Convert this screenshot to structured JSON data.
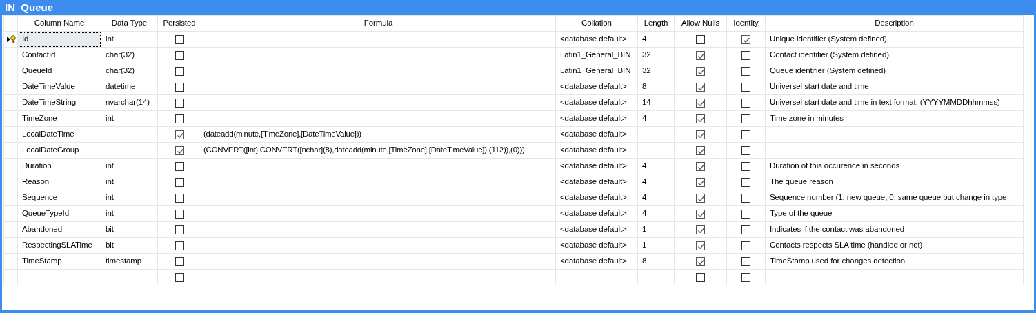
{
  "window": {
    "title": "IN_Queue"
  },
  "table": {
    "columns": [
      "Column Name",
      "Data Type",
      "Persisted",
      "Formula",
      "Collation",
      "Length",
      "Allow Nulls",
      "Identity",
      "Description"
    ],
    "rows": [
      {
        "selected": true,
        "primary_key": true,
        "name": "Id",
        "type": "int",
        "persisted": false,
        "collation": "<database default>",
        "length": "4",
        "allow_nulls": false,
        "identity": true,
        "description": "Unique identifier (System defined)"
      },
      {
        "selected": false,
        "primary_key": false,
        "name": "ContactId",
        "type": "char(32)",
        "persisted": false,
        "collation": "Latin1_General_BIN",
        "length": "32",
        "allow_nulls": true,
        "identity": false,
        "description": "Contact identifier (System defined)"
      },
      {
        "selected": false,
        "primary_key": false,
        "name": "QueueId",
        "type": "char(32)",
        "persisted": false,
        "collation": "Latin1_General_BIN",
        "length": "32",
        "allow_nulls": true,
        "identity": false,
        "description": "Queue identifier (System defined)"
      },
      {
        "selected": false,
        "primary_key": false,
        "name": "DateTimeValue",
        "type": "datetime",
        "persisted": false,
        "collation": "<database default>",
        "length": "8",
        "allow_nulls": true,
        "identity": false,
        "description": "Universel start date and time"
      },
      {
        "selected": false,
        "primary_key": false,
        "name": "DateTimeString",
        "type": "nvarchar(14)",
        "persisted": false,
        "collation": "<database default>",
        "length": "14",
        "allow_nulls": true,
        "identity": false,
        "description": "Universel start date and time in text format. (YYYYMMDDhhmmss)"
      },
      {
        "selected": false,
        "primary_key": false,
        "name": "TimeZone",
        "type": "int",
        "persisted": false,
        "collation": "<database default>",
        "length": "4",
        "allow_nulls": true,
        "identity": false,
        "description": "Time zone in minutes"
      },
      {
        "selected": false,
        "primary_key": false,
        "name": "LocalDateTime",
        "persisted": true,
        "formula": "(dateadd(minute,[TimeZone],[DateTimeValue]))",
        "collation": "<database default>",
        "allow_nulls": true,
        "identity": false
      },
      {
        "selected": false,
        "primary_key": false,
        "name": "LocalDateGroup",
        "persisted": true,
        "formula": "(CONVERT([int],CONVERT([nchar](8),dateadd(minute,[TimeZone],[DateTimeValue]),(112)),(0)))",
        "collation": "<database default>",
        "allow_nulls": true,
        "identity": false
      },
      {
        "selected": false,
        "primary_key": false,
        "name": "Duration",
        "type": "int",
        "persisted": false,
        "collation": "<database default>",
        "length": "4",
        "allow_nulls": true,
        "identity": false,
        "description": "Duration of this occurence in seconds"
      },
      {
        "selected": false,
        "primary_key": false,
        "name": "Reason",
        "type": "int",
        "persisted": false,
        "collation": "<database default>",
        "length": "4",
        "allow_nulls": true,
        "identity": false,
        "description": "The queue reason"
      },
      {
        "selected": false,
        "primary_key": false,
        "name": "Sequence",
        "type": "int",
        "persisted": false,
        "collation": "<database default>",
        "length": "4",
        "allow_nulls": true,
        "identity": false,
        "description": "Sequence number (1: new queue, 0: same queue but change in type"
      },
      {
        "selected": false,
        "primary_key": false,
        "name": "QueueTypeId",
        "type": "int",
        "persisted": false,
        "collation": "<database default>",
        "length": "4",
        "allow_nulls": true,
        "identity": false,
        "description": "Type of the queue"
      },
      {
        "selected": false,
        "primary_key": false,
        "name": "Abandoned",
        "type": "bit",
        "persisted": false,
        "collation": "<database default>",
        "length": "1",
        "allow_nulls": true,
        "identity": false,
        "description": "Indicates if the contact was abandoned"
      },
      {
        "selected": false,
        "primary_key": false,
        "name": "RespectingSLATime",
        "type": "bit",
        "persisted": false,
        "collation": "<database default>",
        "length": "1",
        "allow_nulls": true,
        "identity": false,
        "description": "Contacts respects SLA time (handled or not)"
      },
      {
        "selected": false,
        "primary_key": false,
        "name": "TimeStamp",
        "type": "timestamp",
        "persisted": false,
        "collation": "<database default>",
        "length": "8",
        "allow_nulls": true,
        "identity": false,
        "description": "TimeStamp used for changes detection."
      },
      {
        "selected": false,
        "primary_key": false,
        "persisted": false,
        "allow_nulls": false,
        "identity": false
      }
    ]
  }
}
